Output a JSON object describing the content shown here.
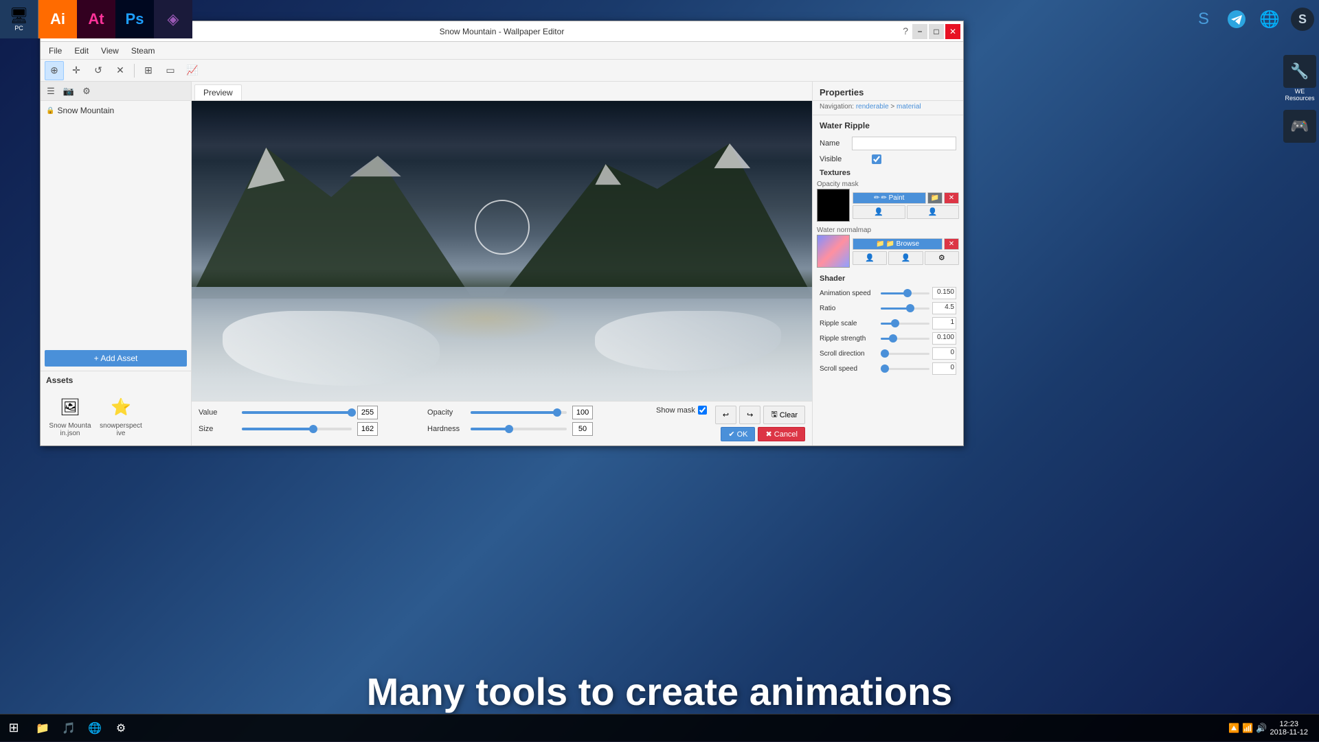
{
  "desktop": {
    "background": "space"
  },
  "title_bar": {
    "title": "Snow Mountain - Wallpaper Editor",
    "minimize": "−",
    "maximize": "□",
    "close": "✕",
    "help": "?"
  },
  "menu": {
    "items": [
      "File",
      "Edit",
      "View",
      "Steam"
    ]
  },
  "toolbar": {
    "buttons": [
      "⊕",
      "✛",
      "↺",
      "✕",
      "⊞",
      "□",
      "📈"
    ]
  },
  "sidebar": {
    "project_name": "Snow Mountain",
    "add_asset_label": "+ Add Asset",
    "assets_label": "Assets",
    "asset_items": [
      {
        "name": "Snow Mountain.json",
        "icon": "🖼"
      },
      {
        "name": "snowperspective",
        "icon": "⭐"
      }
    ]
  },
  "preview": {
    "tab_label": "Preview"
  },
  "paint_controls": {
    "value_label": "Value",
    "value_number": "255",
    "opacity_label": "Opacity",
    "opacity_value": "100",
    "opacity_pct": 90,
    "size_label": "Size",
    "size_number": "162",
    "hardness_label": "Hardness",
    "hardness_value": "50",
    "hardness_pct": 40,
    "show_mask_label": "Show mask",
    "clear_label": "Clear",
    "ok_label": "✔ OK",
    "cancel_label": "✖ Cancel",
    "undo_icon": "↩",
    "redo_icon": "↪",
    "clear_icon": "⬜"
  },
  "properties": {
    "title": "Properties",
    "navigation": "Navigation: renderable > material",
    "section_title": "Water Ripple",
    "name_label": "Name",
    "name_value": "",
    "visible_label": "Visible",
    "textures_title": "Textures",
    "opacity_mask_label": "Opacity mask",
    "paint_btn": "✏ Paint",
    "browse_btn": "📁 Browse",
    "water_normalmap_label": "Water normalmap",
    "shader_title": "Shader",
    "shader_rows": [
      {
        "label": "Animation speed",
        "value": "0.150",
        "pct": 55
      },
      {
        "label": "Ratio",
        "value": "4.5",
        "pct": 60
      },
      {
        "label": "Ripple scale",
        "value": "1",
        "pct": 30
      },
      {
        "label": "Ripple strength",
        "value": "0.100",
        "pct": 25
      },
      {
        "label": "Scroll direction",
        "value": "0",
        "pct": 0
      },
      {
        "label": "Scroll speed",
        "value": "0",
        "pct": 0
      }
    ]
  },
  "overlay": {
    "text": "Many tools to create animations"
  },
  "taskbar": {
    "clock_time": "12:23",
    "clock_date": "2018-11-12"
  },
  "app_icons": [
    {
      "label": "Ai",
      "color": "#FF6B00",
      "bg": "#2a1500"
    },
    {
      "label": "At",
      "color": "#FF3399",
      "bg": "#1a0020"
    },
    {
      "label": "Ps",
      "color": "#1E9FFF",
      "bg": "#000820"
    }
  ]
}
